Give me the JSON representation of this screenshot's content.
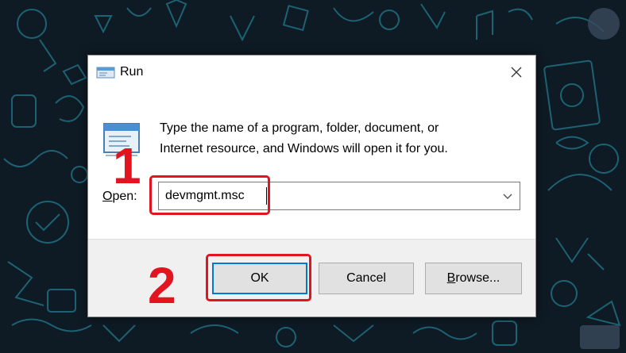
{
  "dialog": {
    "title": "Run",
    "description_line1": "Type the name of a program, folder, document, or",
    "description_line2": "Internet resource, and Windows will open it for you.",
    "open_label_accel": "O",
    "open_label_rest": "pen:",
    "input_value": "devmgmt.msc",
    "buttons": {
      "ok": "OK",
      "cancel": "Cancel",
      "browse_accel": "B",
      "browse_rest": "rowse..."
    }
  },
  "annotations": {
    "step1": "1",
    "step2": "2",
    "highlight_color": "#e1141f"
  },
  "icons": {
    "title": "run-icon",
    "program": "run-program-icon",
    "close": "close-icon",
    "dropdown": "chevron-down-icon"
  },
  "colors": {
    "wallpaper": "#0e1a24",
    "doodles": "#2bb3c9",
    "footer": "#f0f0f0",
    "button": "#e1e1e1",
    "default_button_border": "#0078d7"
  }
}
